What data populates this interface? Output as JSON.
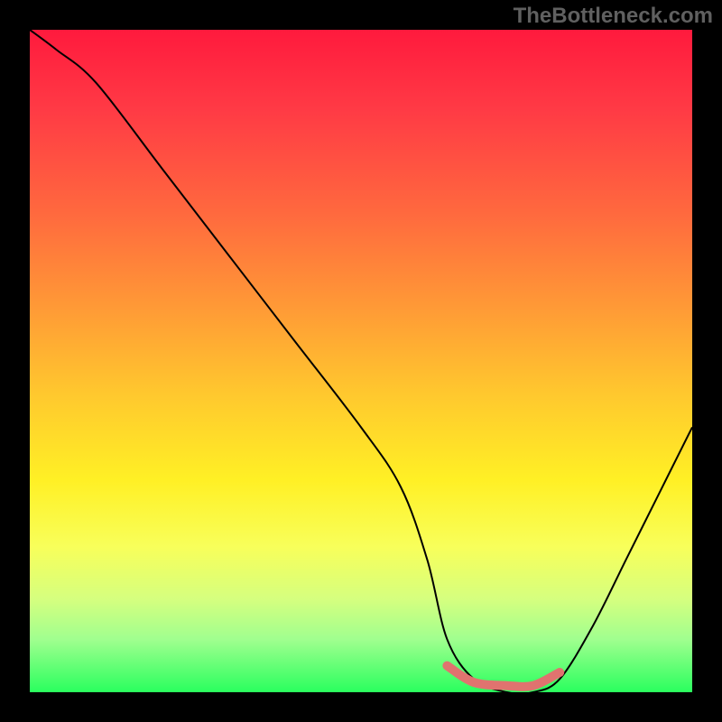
{
  "watermark": "TheBottleneck.com",
  "chart_data": {
    "type": "line",
    "title": "",
    "xlabel": "",
    "ylabel": "",
    "xlim": [
      0,
      100
    ],
    "ylim": [
      0,
      100
    ],
    "series": [
      {
        "name": "curve",
        "x": [
          0,
          4,
          10,
          20,
          30,
          40,
          50,
          56,
          60,
          63,
          67,
          72,
          76,
          80,
          85,
          90,
          95,
          100
        ],
        "values": [
          100,
          97,
          92,
          79,
          66,
          53,
          40,
          31,
          20,
          8,
          2,
          0,
          0,
          2,
          10,
          20,
          30,
          40
        ]
      },
      {
        "name": "minimum-marker",
        "color": "#e0736f",
        "x": [
          63,
          67,
          72,
          76,
          80
        ],
        "values": [
          4,
          1.5,
          1,
          1,
          3
        ]
      }
    ],
    "gradient_stops": [
      {
        "pos": 0,
        "color": "#ff1a3d"
      },
      {
        "pos": 28,
        "color": "#ff6a3e"
      },
      {
        "pos": 55,
        "color": "#ffc82e"
      },
      {
        "pos": 78,
        "color": "#f8ff5a"
      },
      {
        "pos": 100,
        "color": "#2aff5e"
      }
    ]
  }
}
